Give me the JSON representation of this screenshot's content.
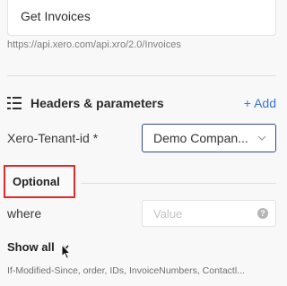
{
  "operation": {
    "name": "Get Invoices",
    "url": "https://api.xero.com/api.xro/2.0/Invoices"
  },
  "headers_section": {
    "title": "Headers & parameters",
    "icon": "list-icon",
    "add_label": "+ Add",
    "accent_color": "#3a73d6"
  },
  "required_params": [
    {
      "label": "Xero-Tenant-id *",
      "value": "Demo Compan..."
    }
  ],
  "optional_section": {
    "title": "Optional",
    "highlight_color": "#e02b2b",
    "params": [
      {
        "label": "where",
        "placeholder": "Value"
      }
    ]
  },
  "show_all": {
    "label": "Show all",
    "hint": "If-Modified-Since, order, IDs, InvoiceNumbers, Contactl..."
  }
}
